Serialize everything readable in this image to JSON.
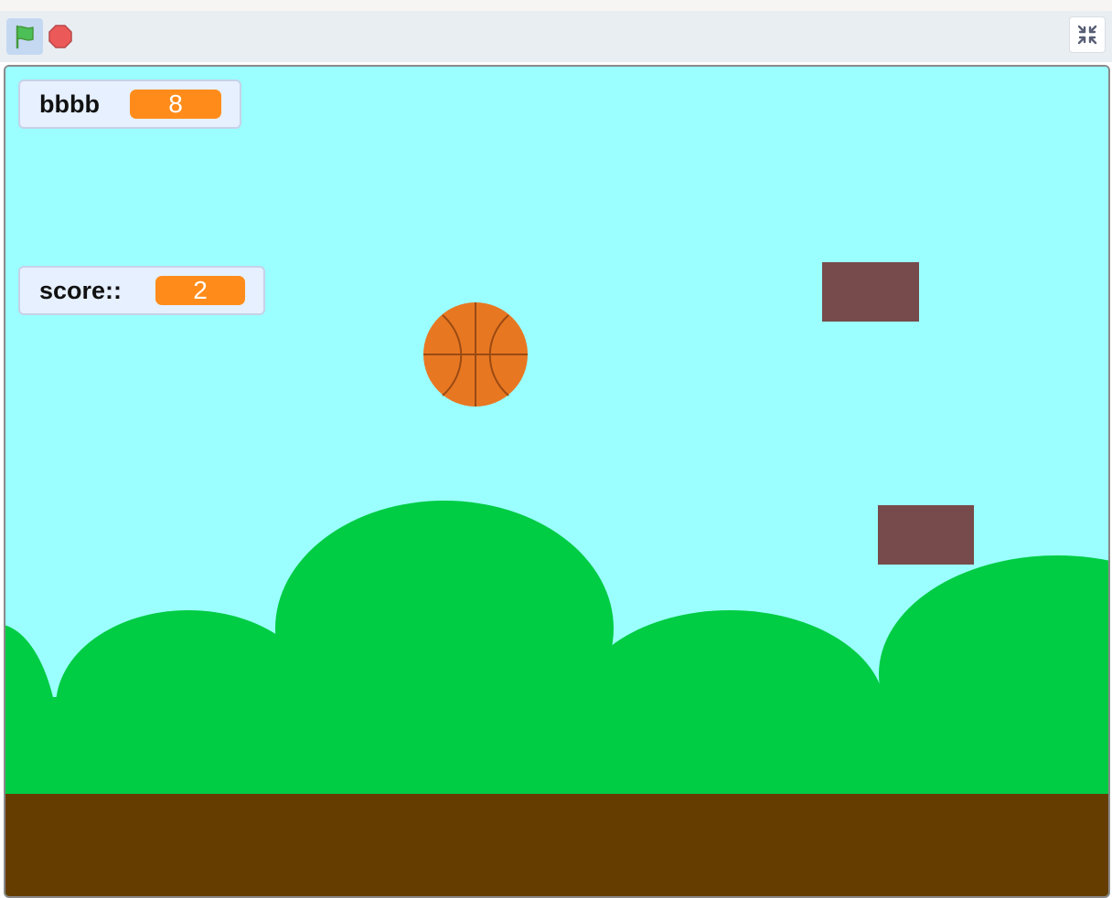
{
  "controls": {
    "green_flag_icon": "green-flag-icon",
    "stop_icon": "stop-sign-icon",
    "exit_fullscreen_icon": "exit-fullscreen-icon"
  },
  "monitors": [
    {
      "label": "bbbb",
      "value": "8"
    },
    {
      "label": "score::",
      "value": "2"
    }
  ],
  "colors": {
    "sky": "#9bffff",
    "bushes": "#00cc44",
    "ground": "#663d00",
    "ball": "#e87722",
    "blocks": "#774b4b",
    "monitor_value_bg": "#ff8c1a"
  }
}
